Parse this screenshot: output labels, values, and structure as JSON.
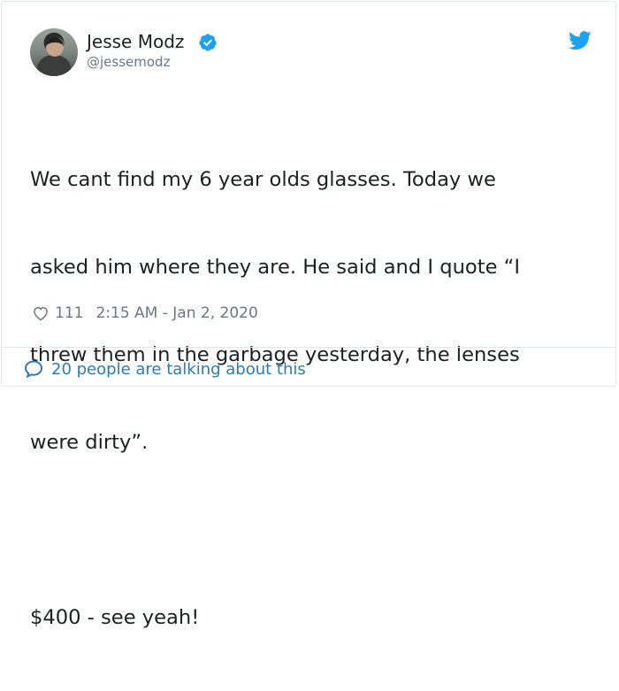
{
  "author": {
    "name": "Jesse Modz",
    "handle": "@jessemodz",
    "verified": true,
    "avatar_icon": "profile-photo"
  },
  "tweet": {
    "text_lines": [
      "We cant find my 6 year olds glasses. Today we",
      "asked him where they are. He said and I quote “I",
      "threw them in the garbage yesterday, the lenses",
      "were dirty”.",
      "",
      "$400 - see yeah!"
    ],
    "likes": "111",
    "timestamp": "2:15 AM - Jan 2, 2020"
  },
  "footer": {
    "conversation_label": "20 people are talking about this"
  },
  "icons": {
    "verified": "verified-badge-icon",
    "brand": "twitter-bird-icon",
    "like": "heart-icon",
    "reply": "speech-bubble-icon"
  },
  "colors": {
    "brand_blue": "#1da1f2",
    "link_blue": "#2b7bb9",
    "text": "#1c2022",
    "muted": "#697882",
    "border": "#e1e8ed"
  }
}
